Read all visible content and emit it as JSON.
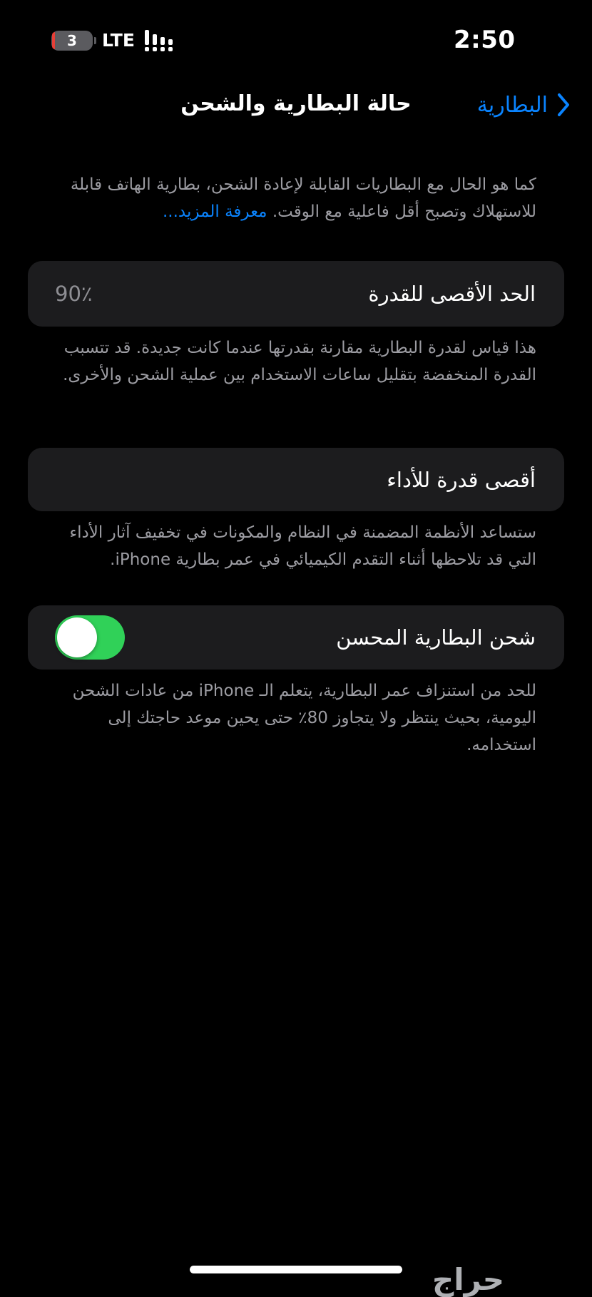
{
  "status_bar": {
    "time": "2:50",
    "battery_level": "3",
    "network": "LTE",
    "battery_fill_percent": 3,
    "colors": {
      "battery_body": "#5b5b5f",
      "battery_low_accent": "#ff3b30"
    },
    "icons": [
      "battery-icon",
      "signal-icon"
    ]
  },
  "nav": {
    "title": "حالة البطارية والشحن",
    "back_label": "البطارية",
    "back_icon": "chevron-right-icon"
  },
  "intro": {
    "text": "كما هو الحال مع البطاريات القابلة لإعادة الشحن، بطارية الهاتف قابلة للاستهلاك وتصبح أقل فاعلية مع الوقت.",
    "link": "معرفة المزيد..."
  },
  "max_capacity": {
    "label": "الحد الأقصى للقدرة",
    "value": "90٪",
    "description": "هذا قياس لقدرة البطارية مقارنة بقدرتها عندما كانت جديدة. قد تتسبب القدرة المنخفضة بتقليل ساعات الاستخدام بين عملية الشحن والأخرى."
  },
  "performance": {
    "label": "أقصى قدرة للأداء",
    "description": "ستساعد الأنظمة المضمنة في النظام والمكونات في تخفيف آثار الأداء التي قد تلاحظها أثناء التقدم الكيميائي في عمر بطارية iPhone."
  },
  "optimized_charging": {
    "label": "شحن البطارية المحسن",
    "enabled": true,
    "description": "للحد من استنزاف عمر البطارية، يتعلم الـ iPhone من عادات الشحن اليومية، بحيث ينتظر ولا يتجاوز 80٪ حتى يحين موعد حاجتك إلى استخدامه."
  },
  "watermark": "حراج",
  "colors": {
    "background": "#000000",
    "card": "#1c1c1e",
    "accent": "#0a84ff",
    "toggle_on": "#30d158",
    "secondary_text": "#9c9ca2"
  }
}
